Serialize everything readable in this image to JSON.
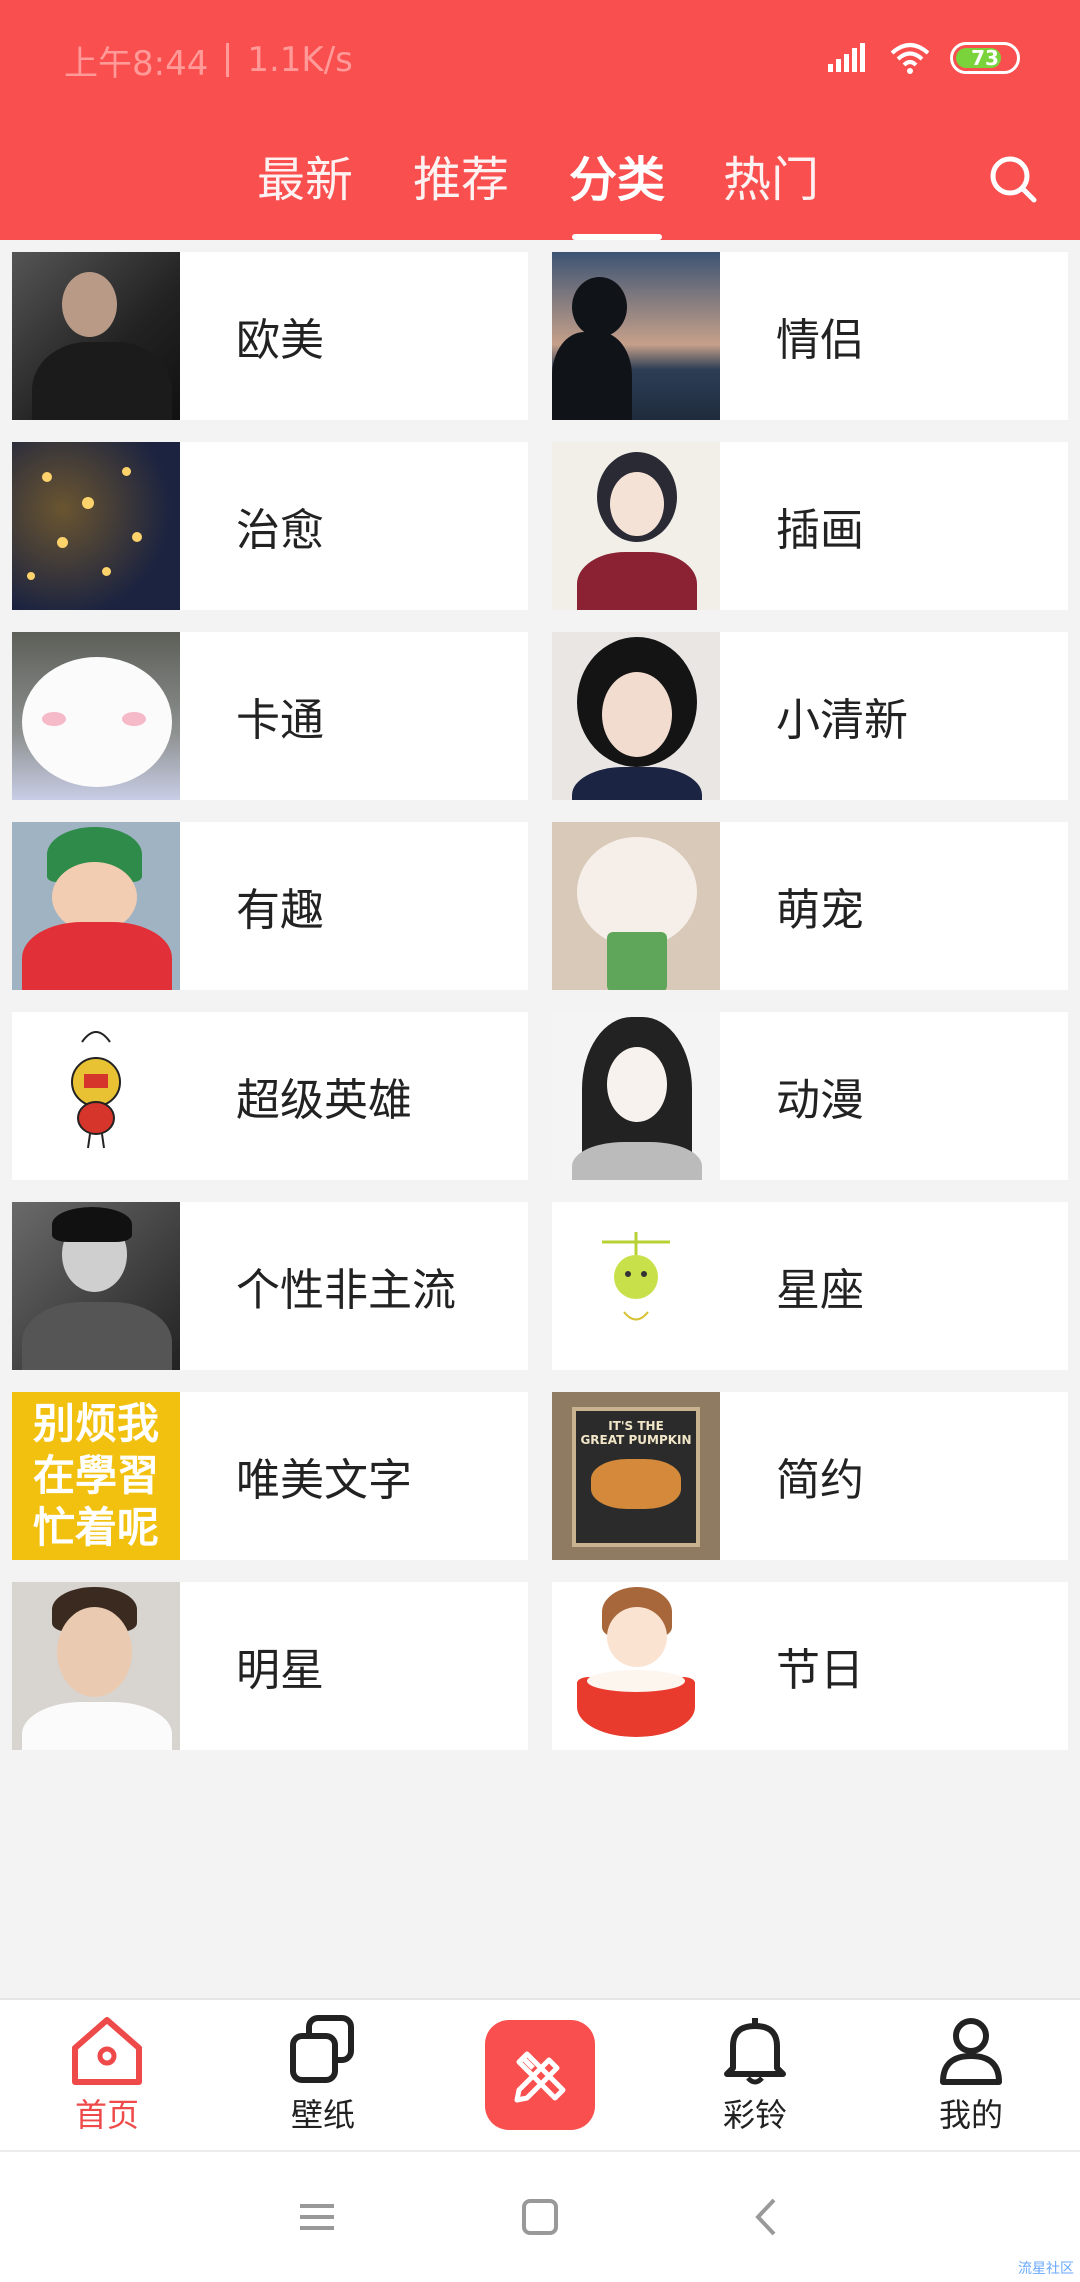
{
  "status_bar": {
    "time": "上午8:44",
    "speed": "1.1K/s",
    "battery": "73"
  },
  "tabs": [
    {
      "label": "最新",
      "active": false
    },
    {
      "label": "推荐",
      "active": false
    },
    {
      "label": "分类",
      "active": true
    },
    {
      "label": "热门",
      "active": false
    }
  ],
  "categories": [
    {
      "label": "欧美",
      "thumb": "portrait-man-dark"
    },
    {
      "label": "情侣",
      "thumb": "silhouette-sunset"
    },
    {
      "label": "治愈",
      "thumb": "star-lights-night"
    },
    {
      "label": "插画",
      "thumb": "illustrated-girl"
    },
    {
      "label": "卡通",
      "thumb": "white-cat-cartoon"
    },
    {
      "label": "小清新",
      "thumb": "girl-selfie"
    },
    {
      "label": "有趣",
      "thumb": "child-green-hat"
    },
    {
      "label": "萌宠",
      "thumb": "white-cat"
    },
    {
      "label": "超级英雄",
      "thumb": "ironman-sketch"
    },
    {
      "label": "动漫",
      "thumb": "anime-longhair"
    },
    {
      "label": "个性非主流",
      "thumb": "man-black-white"
    },
    {
      "label": "星座",
      "thumb": "libra-cartoon"
    },
    {
      "label": "唯美文字",
      "thumb": "text-poster",
      "thumb_text": [
        "别烦我",
        "在學習",
        "忙着呢"
      ]
    },
    {
      "label": "简约",
      "thumb": "pumpkin-poster",
      "thumb_text": [
        "IT'S THE",
        "GREAT PUMPKIN"
      ]
    },
    {
      "label": "明星",
      "thumb": "star-man-glasses"
    },
    {
      "label": "节日",
      "thumb": "chibi-bowl"
    }
  ],
  "bottom_nav": {
    "home": "首页",
    "wallpaper": "壁纸",
    "ringtone": "彩铃",
    "mine": "我的"
  },
  "watermark": "流星社区",
  "colors": {
    "accent": "#f94f4f",
    "active_nav": "#ef4a4a"
  }
}
